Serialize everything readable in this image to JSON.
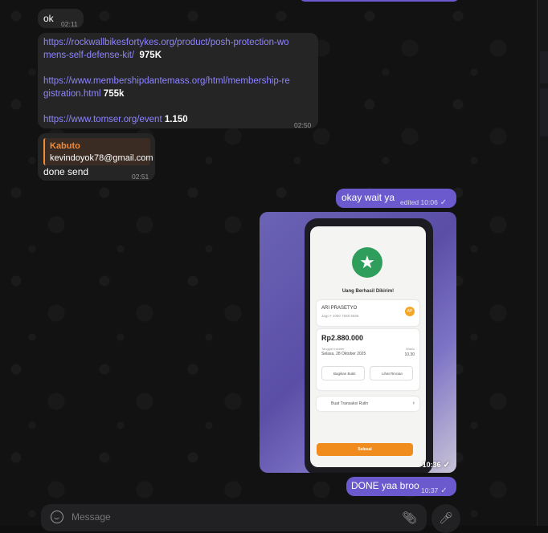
{
  "messages": {
    "m1": {
      "text": "ok",
      "time": "02:11"
    },
    "m2": {
      "links": [
        {
          "url_line1": "https://rockwallbikesfortykes.org/product/posh-protection-wo",
          "url_line2": "mens-self-defense-kit/",
          "amount": "975K"
        },
        {
          "url_line1": "https://www.membershipdantemass.org/html/membership-re",
          "url_line2": "gistration.html",
          "amount": "755k"
        },
        {
          "url_line1": "https://www.tomser.org/event",
          "amount": "1.150"
        }
      ],
      "time": "02:50"
    },
    "m3": {
      "reply_name": "Kabuto",
      "reply_text": "kevindoyok78@gmail.com",
      "text": "done send",
      "time": "02:51"
    },
    "m4": {
      "text": "okay wait ya",
      "time": "edited 10:06",
      "check": "✓"
    },
    "m5": {
      "time": "10:36",
      "check": "✓",
      "phone_screen": {
        "title": "Uang Berhasil Dikirim!",
        "recipient": "ARI PRASETYO",
        "recipient_sub": "Jago • 1060 7569 6566",
        "avatar": "AP",
        "amount": "Rp2.880.000",
        "date_label": "Tanggal transfer",
        "date_value": "Selasa, 28 Oktober 2025",
        "time_label": "Waktu",
        "time_value": "10.30",
        "btn_share": "Bagikan Bukti",
        "btn_receipt": "Lihat Rincian",
        "routine": "Buat Transaksi Rutin",
        "done": "Selesai"
      }
    },
    "m6": {
      "text": "DONE yaa broo",
      "time": "10:37",
      "check": "✓"
    }
  },
  "composer": {
    "placeholder": "Message"
  },
  "colors": {
    "outgoing": "#6a5acd",
    "incoming": "#252526",
    "link": "#8e84ff",
    "reply_accent": "#f08b3a"
  },
  "icons": {
    "emoji": "emoji-icon",
    "attach": "paperclip-icon",
    "mic": "microphone-icon",
    "star": "star-icon"
  }
}
